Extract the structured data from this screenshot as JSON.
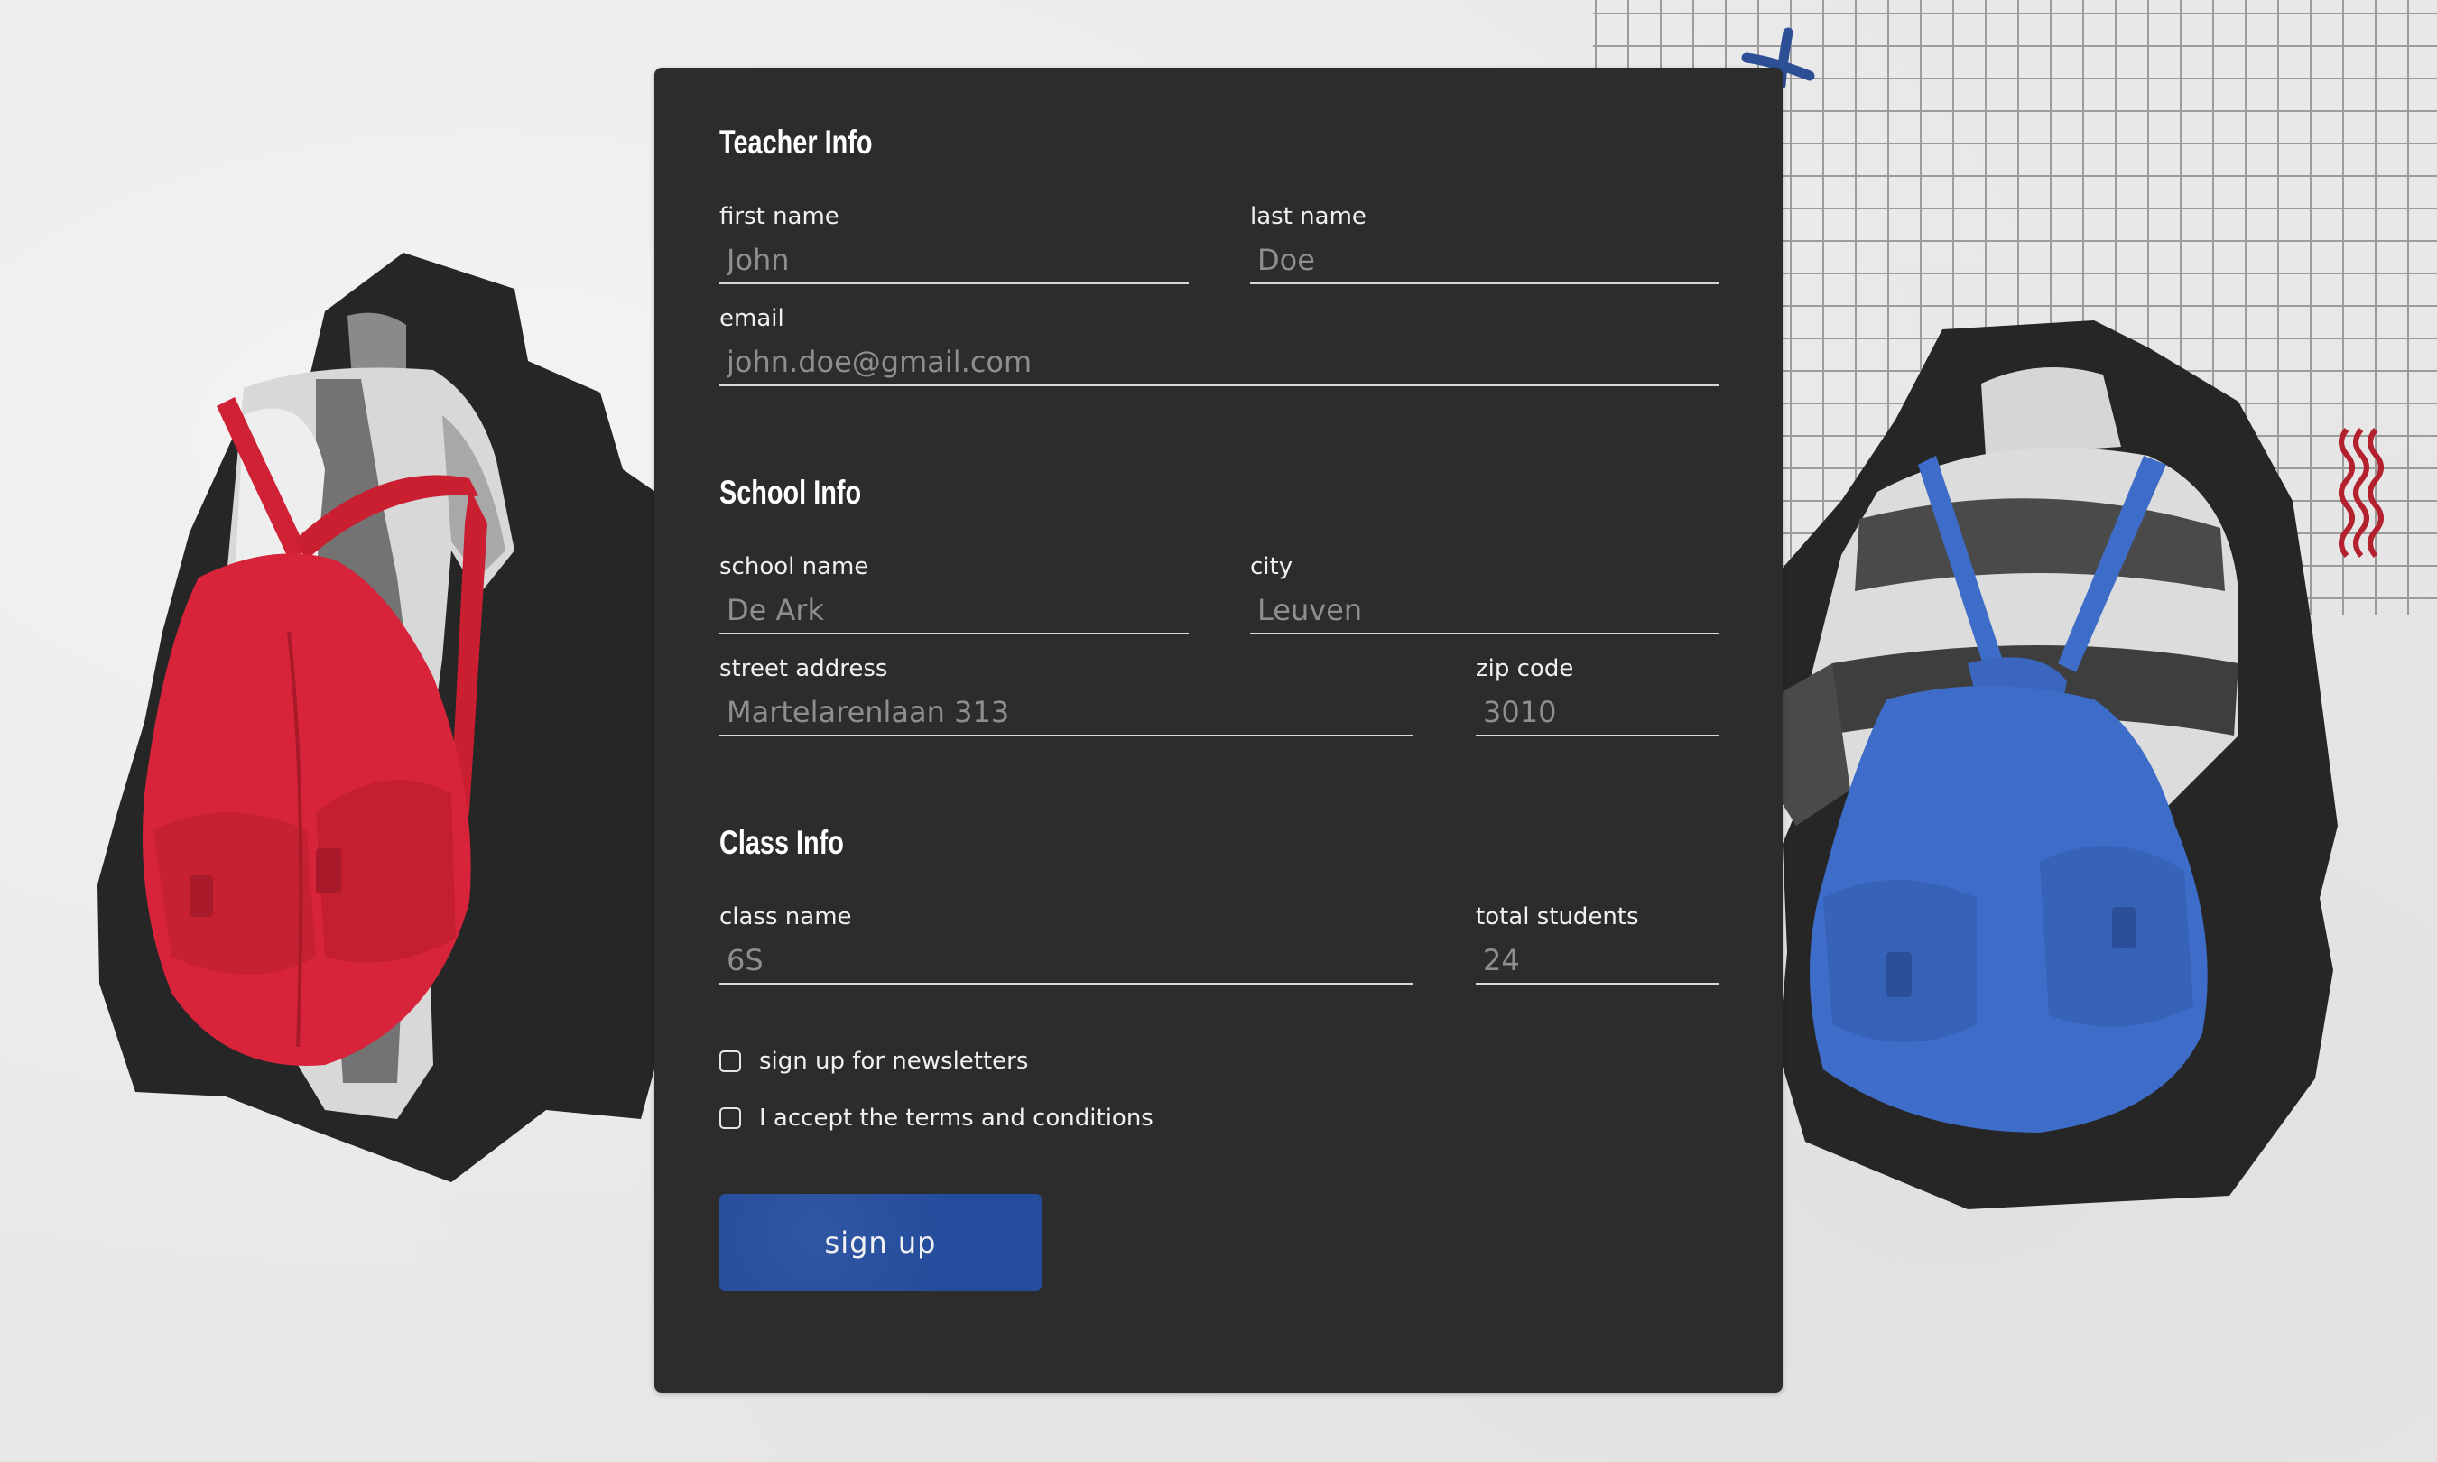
{
  "sections": {
    "teacher": {
      "title": "Teacher Info",
      "first_name": {
        "label": "first name",
        "placeholder": "John"
      },
      "last_name": {
        "label": "last name",
        "placeholder": "Doe"
      },
      "email": {
        "label": "email",
        "placeholder": "john.doe@gmail.com"
      }
    },
    "school": {
      "title": "School Info",
      "school_name": {
        "label": "school name",
        "placeholder": "De Ark"
      },
      "city": {
        "label": "city",
        "placeholder": "Leuven"
      },
      "street": {
        "label": "street address",
        "placeholder": "Martelarenlaan 313"
      },
      "zip": {
        "label": "zip code",
        "placeholder": "3010"
      }
    },
    "class": {
      "title": "Class Info",
      "class_name": {
        "label": "class name",
        "placeholder": "6S"
      },
      "total_students": {
        "label": "total students",
        "placeholder": "24"
      }
    }
  },
  "checkboxes": {
    "newsletter": "sign up for newsletters",
    "terms": "I accept the terms and conditions"
  },
  "button": {
    "label": "sign up"
  },
  "colors": {
    "card": "#2c2c2c",
    "button": "#234c9c",
    "red_backpack": "#d8243a",
    "blue_backpack": "#3d6dc8"
  },
  "decor": [
    "cross-icon",
    "squiggle-icon",
    "grid-paper",
    "red-backpack-figure",
    "blue-backpack-figure"
  ]
}
